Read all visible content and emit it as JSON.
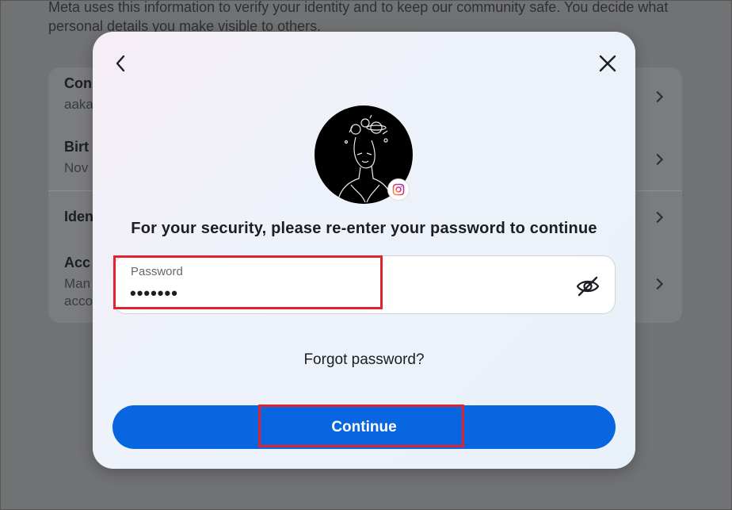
{
  "background": {
    "intro": "Meta uses this information to verify your identity and to keep our community safe. You decide what personal details you make visible to others.",
    "rows": [
      {
        "title": "Con",
        "sub": "aaka"
      },
      {
        "title": "Birt",
        "sub": "Nov"
      },
      {
        "title": "Iden",
        "sub": ""
      },
      {
        "title": "Acc",
        "sub": "Man",
        "sub2": "acco"
      }
    ]
  },
  "modal": {
    "back_icon": "chevron-left-icon",
    "close_icon": "close-icon",
    "heading": "For your security, please re-enter your password to continue",
    "password": {
      "label": "Password",
      "value": "•••••••",
      "toggle_icon": "eye-slash-icon"
    },
    "forgot_label": "Forgot password?",
    "continue_label": "Continue",
    "badge_icon": "instagram-icon"
  },
  "colors": {
    "primary": "#0866e1",
    "highlight": "#e0242f"
  }
}
